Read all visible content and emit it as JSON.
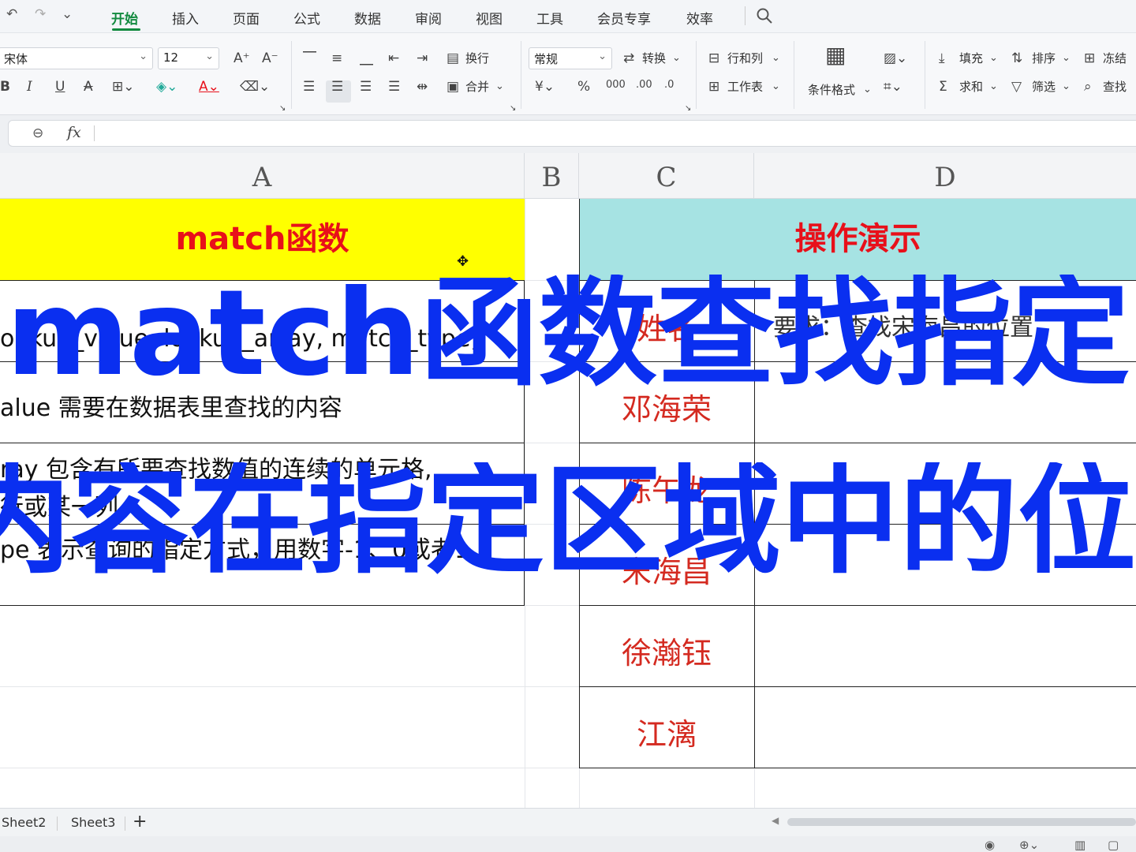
{
  "quick_access": {
    "undo": "↶",
    "redo": "↷",
    "more": "⌄"
  },
  "menu": {
    "tabs": [
      "开始",
      "插入",
      "页面",
      "公式",
      "数据",
      "审阅",
      "视图",
      "工具",
      "会员专享",
      "效率"
    ],
    "active": "开始"
  },
  "ribbon": {
    "font_name": "宋体",
    "font_size": "12",
    "wrap": "换行",
    "merge": "合并",
    "number_format": "常规",
    "convert": "转换",
    "rows_cols": "行和列",
    "worksheet": "工作表",
    "conditional_format": "条件格式",
    "fill": "填充",
    "sort": "排序",
    "freeze": "冻结",
    "sum": "求和",
    "filter": "筛选",
    "find": "查找"
  },
  "formula_bar": {
    "fx": "fx",
    "content": ""
  },
  "columns": [
    "A",
    "B",
    "C",
    "D"
  ],
  "sheet": {
    "a_header": "match函数",
    "cd_header": "操作演示",
    "a_rows": [
      "ookup_value, lookup_array, match_type)",
      "alue  需要在数据表里查找的内容",
      "ray  包含有所要查找数值的连续的单元格,",
      "行或某一列",
      "pe  表示查询的指定方式，用数字-1、0或者1"
    ],
    "names": [
      "姓名",
      "邓海荣",
      "陈午龙",
      "宋海昌",
      "徐瀚钰",
      "江漓"
    ],
    "d_first": "要求：查找宋海昌的位置"
  },
  "overlay": {
    "line1": "match函数查找指定",
    "line2": "内容在指定区域中的位置"
  },
  "sheet_tabs": [
    "Sheet2",
    "Sheet3"
  ],
  "add_sheet": "+"
}
